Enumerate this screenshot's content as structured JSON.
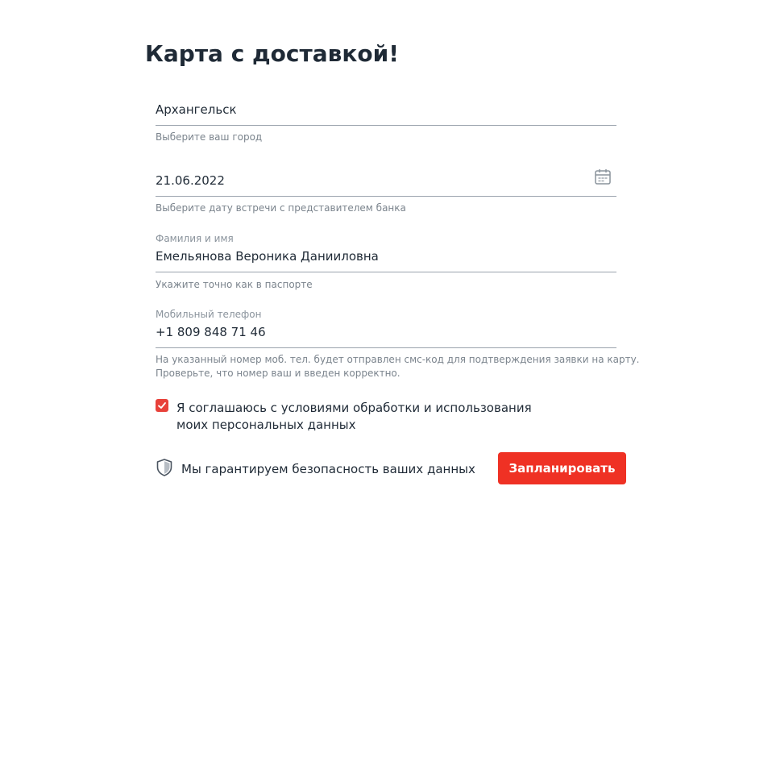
{
  "page": {
    "title": "Карта с доставкой!"
  },
  "form": {
    "city": {
      "value": "Архангельск",
      "hint": "Выберите ваш город"
    },
    "date": {
      "value": "21.06.2022",
      "hint": "Выберите дату встречи с представителем банка",
      "icon": "calendar-icon"
    },
    "name": {
      "label": "Фамилия и имя",
      "value": "Емельянова Вероника Данииловна",
      "hint": "Укажите точно как в паспорте"
    },
    "phone": {
      "label": "Мобильный телефон",
      "value": "+1 809 848 71 46",
      "hint_line1": "На указанный номер моб. тел. будет отправлен смс-код для подтверждения заявки на карту.",
      "hint_line2": "Проверьте, что номер ваш и введен корректно."
    },
    "consent": {
      "checked": true,
      "label": "Я соглашаюсь с условиями обработки и использования моих персональных данных"
    },
    "security": {
      "icon": "shield-icon",
      "text": "Мы гарантируем безопасность ваших данных"
    },
    "submit": {
      "label": "Запланировать"
    }
  },
  "colors": {
    "accent": "#ef3124",
    "text": "#1f2a36",
    "muted": "#7b848d",
    "divider": "#9aa3ad"
  }
}
